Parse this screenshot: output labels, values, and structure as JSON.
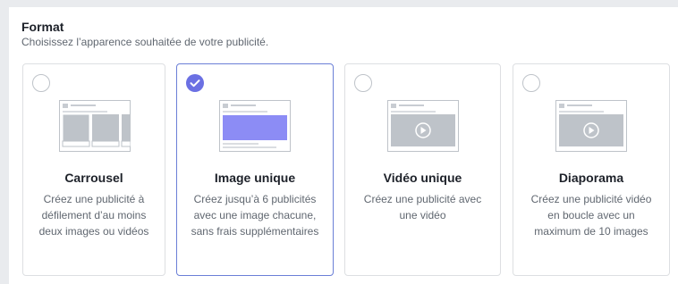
{
  "section": {
    "title": "Format",
    "subtitle": "Choisissez l’apparence souhaitée de votre publicité."
  },
  "cards": [
    {
      "title": "Carrousel",
      "description": "Créez une publicité à défilement d’au moins deux images ou vidéos",
      "selected": false,
      "icon": "carousel-thumbnail-icon"
    },
    {
      "title": "Image unique",
      "description": "Créez jusqu’à 6 publicités avec une image chacune, sans frais supplémentaires",
      "selected": true,
      "icon": "single-image-thumbnail-icon"
    },
    {
      "title": "Vidéo unique",
      "description": "Créez une publicité avec une vidéo",
      "selected": false,
      "icon": "single-video-thumbnail-icon"
    },
    {
      "title": "Diaporama",
      "description": "Créez une publicité vidéo en boucle avec un maximum de 10 images",
      "selected": false,
      "icon": "slideshow-thumbnail-icon"
    }
  ],
  "colors": {
    "accent": "#6b70e3",
    "selected_border": "#6b7fd7",
    "highlight_fill": "#8c8cf5"
  }
}
